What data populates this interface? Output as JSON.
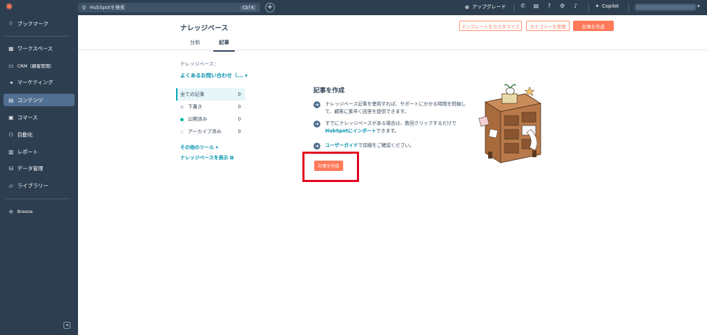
{
  "topbar": {
    "search_placeholder": "HubSpotを検索",
    "search_shortcut": "Ctrl K",
    "upgrade_label": "アップグレード",
    "copilot_label": "Copilot"
  },
  "sidebar": {
    "items": [
      {
        "label": "ブックマーク",
        "icon": "bookmark-icon"
      },
      {
        "label": "ワークスペース",
        "icon": "workspace-icon"
      },
      {
        "label": "CRM（顧客管理）",
        "icon": "crm-icon"
      },
      {
        "label": "マーケティング",
        "icon": "marketing-icon"
      },
      {
        "label": "コンテンツ",
        "icon": "content-icon"
      },
      {
        "label": "コマース",
        "icon": "commerce-icon"
      },
      {
        "label": "自動化",
        "icon": "automation-icon"
      },
      {
        "label": "レポート",
        "icon": "report-icon"
      },
      {
        "label": "データ管理",
        "icon": "data-icon"
      },
      {
        "label": "ライブラリー",
        "icon": "library-icon"
      },
      {
        "label": "Breeze",
        "icon": "breeze-icon"
      }
    ]
  },
  "header": {
    "title": "ナレッジベース",
    "tabs": [
      {
        "label": "分析"
      },
      {
        "label": "記事"
      }
    ],
    "buttons": {
      "customize_template": "テンプレートをカスタマイズ",
      "manage_categories": "カテゴリーを管理",
      "create_article": "記事を作成"
    }
  },
  "left_panel": {
    "kb_label": "ナレッジベース：",
    "kb_selected": "よくあるお問い合わせ（... ▾",
    "filters": [
      {
        "label": "全ての記事",
        "count": "0",
        "dot": ""
      },
      {
        "label": "下書き",
        "count": "0",
        "dot": "#cbd6e2"
      },
      {
        "label": "公開済み",
        "count": "0",
        "dot": "#00bda5"
      },
      {
        "label": "アーカイブ済み",
        "count": "0",
        "dot": "#eaf0f6"
      }
    ],
    "other_tools": "その他のツール ▾",
    "view_kb": "ナレッジベースを表示"
  },
  "empty_state": {
    "title": "記事を作成",
    "bullet1": "ナレッジベース記事を使用すれば、サポートにかかる時間を短縮して、顧客に素早く回答を提供できます。",
    "bullet2_pre": "すでにナレッジベースがある場合は、数回クリックするだけで",
    "bullet2_link": "HubSpotにインポート",
    "bullet2_post": "できます。",
    "bullet3_link": "ユーザーガイド",
    "bullet3_post": "で詳細をご確認ください。",
    "create_button": "記事を作成"
  },
  "colors": {
    "nav_bg": "#2d3e50",
    "accent": "#ff7a59",
    "link": "#0091ae",
    "highlight": "#e3001b"
  }
}
